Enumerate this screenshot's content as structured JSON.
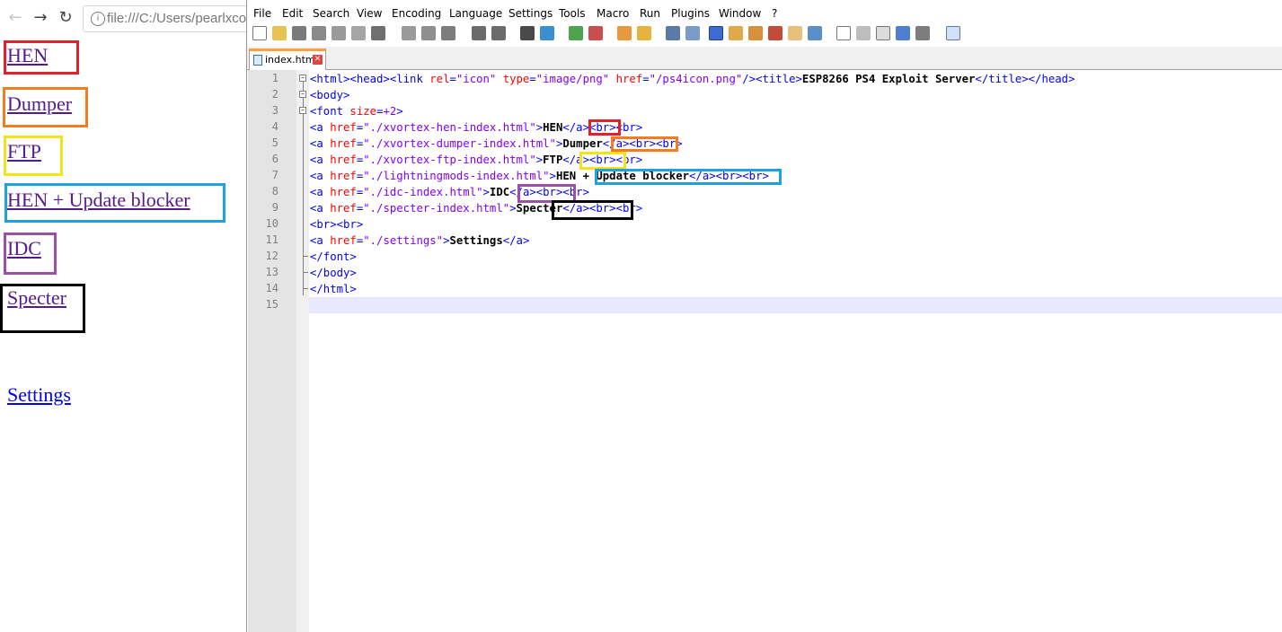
{
  "browser": {
    "url": "file:///C:/Users/pearlxcore",
    "back_icon": "arrow-back-icon",
    "forward_icon": "arrow-forward-icon",
    "reload_icon": "reload-icon",
    "links": [
      {
        "label": "HEN",
        "box_color": "#e0212b"
      },
      {
        "label": "Dumper",
        "box_color": "#f47b20"
      },
      {
        "label": "FTP",
        "box_color": "#f5e31a"
      },
      {
        "label": "HEN + Update blocker",
        "box_color": "#1da1e0"
      },
      {
        "label": "IDC",
        "box_color": "#9c4fa8"
      },
      {
        "label": "Specter",
        "box_color": "#000000"
      },
      {
        "label": "Settings",
        "box_color": ""
      }
    ]
  },
  "editor": {
    "menu": [
      "File",
      "Edit",
      "Search",
      "View",
      "Encoding",
      "Language",
      "Settings",
      "Tools",
      "Macro",
      "Run",
      "Plugins",
      "Window",
      "?"
    ],
    "tab": {
      "label": "index.html",
      "close_icon": "close-icon",
      "file_icon": "file-icon"
    },
    "line_numbers": [
      "1",
      "2",
      "3",
      "4",
      "5",
      "6",
      "7",
      "8",
      "9",
      "10",
      "11",
      "12",
      "13",
      "14",
      "15"
    ],
    "code": {
      "l1": {
        "t1": "<html><head><link ",
        "a1": "rel",
        "t2": "=",
        "v1": "\"icon\"",
        "a2": " type",
        "t3": "=",
        "v2": "\"image/png\"",
        "a3": " href",
        "t4": "=",
        "v3": "\"/ps4icon.png\"",
        "t5": "/><title>",
        "txt": "ESP8266 PS4 Exploit Server",
        "t6": "</title></head>"
      },
      "l2": {
        "t1": "<body>"
      },
      "l3": {
        "t1": "<font ",
        "a1": "size",
        "t2": "=",
        "v1": "+2",
        "t3": ">"
      },
      "l4": {
        "t1": "<a ",
        "a1": "href",
        "t2": "=",
        "v1": "\"./xvortex-hen-index.html\"",
        "t3": ">",
        "txt": "HEN",
        "t4": "</a><br><br>"
      },
      "l5": {
        "t1": "<a ",
        "a1": "href",
        "t2": "=",
        "v1": "\"./xvortex-dumper-index.html\"",
        "t3": ">",
        "txt": "Dumper",
        "t4": "</a><br><br>"
      },
      "l6": {
        "t1": "<a ",
        "a1": "href",
        "t2": "=",
        "v1": "\"./xvortex-ftp-index.html\"",
        "t3": ">",
        "txt": "FTP",
        "t4": "</a><br><br>"
      },
      "l7": {
        "t1": "<a ",
        "a1": "href",
        "t2": "=",
        "v1": "\"./lightningmods-index.html\"",
        "t3": ">",
        "txt": "HEN + Update blocker",
        "t4": "</a><br><br>"
      },
      "l8": {
        "t1": "<a ",
        "a1": "href",
        "t2": "=",
        "v1": "\"./idc-index.html\"",
        "t3": ">",
        "txt": "IDC",
        "t4": "</a><br><br>"
      },
      "l9": {
        "t1": "<a ",
        "a1": "href",
        "t2": "=",
        "v1": "\"./specter-index.html\"",
        "t3": ">",
        "txt": "Specter",
        "t4": "</a><br><br>"
      },
      "l10": {
        "t1": "<br><br>"
      },
      "l11": {
        "t1": "<a ",
        "a1": "href",
        "t2": "=",
        "v1": "\"./settings\"",
        "t3": ">",
        "txt": "Settings",
        "t4": "</a>"
      },
      "l12": {
        "t1": "</font>"
      },
      "l13": {
        "t1": "</body>"
      },
      "l14": {
        "t1": "</html>"
      }
    },
    "colors": {
      "tag": "#0000ff",
      "attr": "#ff0000",
      "value": "#8000ff",
      "caret_line": "#e8e8ff"
    }
  }
}
